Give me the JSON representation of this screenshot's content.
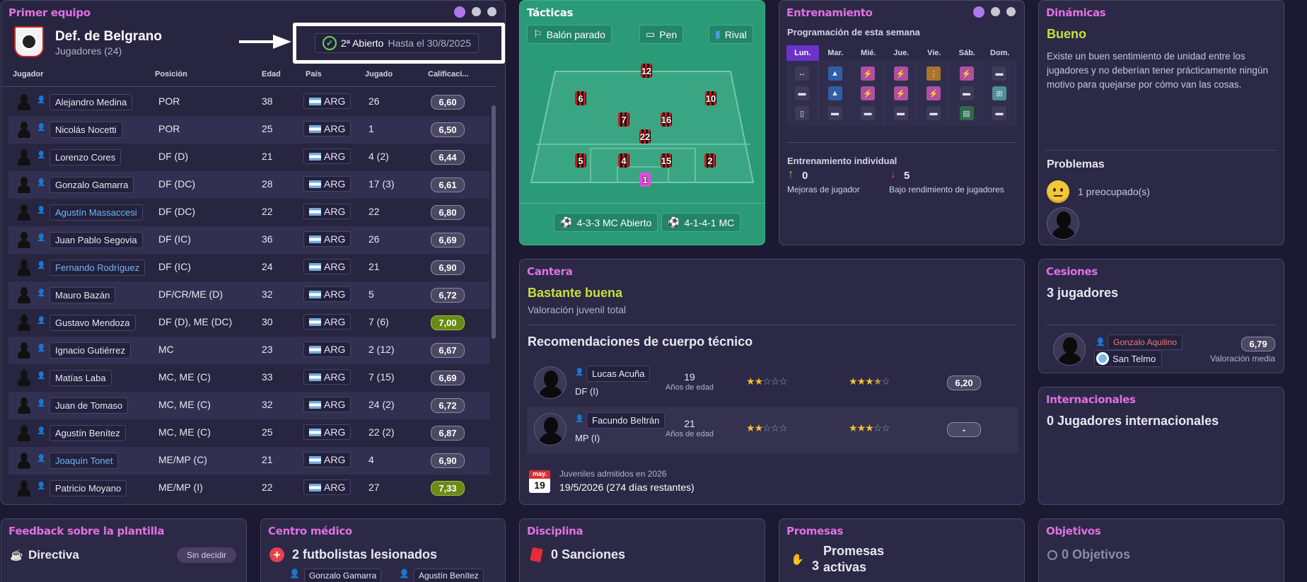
{
  "squad": {
    "title": "Primer equipo",
    "club": "Def. de Belgrano",
    "count": "Jugadores (24)",
    "status_label": "2ª Abierto",
    "status_until": "Hasta el 30/8/2025",
    "columns": [
      "Jugador",
      "Posición",
      "Edad",
      "País",
      "Jugado",
      "Calificaci..."
    ],
    "players": [
      {
        "name": "Alejandro Medina",
        "pos": "POR",
        "age": "38",
        "country": "ARG",
        "played": "26",
        "rating": "6,60",
        "link": false,
        "green": false
      },
      {
        "name": "Nicolás Nocetti",
        "pos": "POR",
        "age": "25",
        "country": "ARG",
        "played": "1",
        "rating": "6,50",
        "link": false,
        "green": false
      },
      {
        "name": "Lorenzo Cores",
        "pos": "DF (D)",
        "age": "21",
        "country": "ARG",
        "played": "4 (2)",
        "rating": "6,44",
        "link": false,
        "green": false
      },
      {
        "name": "Gonzalo Gamarra",
        "pos": "DF (DC)",
        "age": "28",
        "country": "ARG",
        "played": "17 (3)",
        "rating": "6,61",
        "link": false,
        "green": false
      },
      {
        "name": "Agustín Massaccesi",
        "pos": "DF (DC)",
        "age": "22",
        "country": "ARG",
        "played": "22",
        "rating": "6,80",
        "link": true,
        "green": false
      },
      {
        "name": "Juan Pablo Segovia",
        "pos": "DF (IC)",
        "age": "36",
        "country": "ARG",
        "played": "26",
        "rating": "6,69",
        "link": false,
        "green": false
      },
      {
        "name": "Fernando Rodríguez",
        "pos": "DF (IC)",
        "age": "24",
        "country": "ARG",
        "played": "21",
        "rating": "6,90",
        "link": true,
        "green": false
      },
      {
        "name": "Mauro Bazán",
        "pos": "DF/CR/ME (D)",
        "age": "32",
        "country": "ARG",
        "played": "5",
        "rating": "6,72",
        "link": false,
        "green": false
      },
      {
        "name": "Gustavo Mendoza",
        "pos": "DF (D), ME (DC)",
        "age": "30",
        "country": "ARG",
        "played": "7 (6)",
        "rating": "7,00",
        "link": false,
        "green": true
      },
      {
        "name": "Ignacio Gutiérrez",
        "pos": "MC",
        "age": "23",
        "country": "ARG",
        "played": "2 (12)",
        "rating": "6,67",
        "link": false,
        "green": false
      },
      {
        "name": "Matías Laba",
        "pos": "MC, ME (C)",
        "age": "33",
        "country": "ARG",
        "played": "7 (15)",
        "rating": "6,69",
        "link": false,
        "green": false
      },
      {
        "name": "Juan de Tomaso",
        "pos": "MC, ME (C)",
        "age": "32",
        "country": "ARG",
        "played": "24 (2)",
        "rating": "6,72",
        "link": false,
        "green": false
      },
      {
        "name": "Agustín Benítez",
        "pos": "MC, ME (C)",
        "age": "25",
        "country": "ARG",
        "played": "22 (2)",
        "rating": "6,87",
        "link": false,
        "green": false
      },
      {
        "name": "Joaquín Tonet",
        "pos": "ME/MP (C)",
        "age": "21",
        "country": "ARG",
        "played": "4",
        "rating": "6,90",
        "link": true,
        "green": false
      },
      {
        "name": "Patricio Moyano",
        "pos": "ME/MP (I)",
        "age": "22",
        "country": "ARG",
        "played": "27",
        "rating": "7,33",
        "link": false,
        "green": true
      }
    ]
  },
  "tactics": {
    "title": "Tácticas",
    "tabs": [
      "Balón parado",
      "Pen",
      "Rival"
    ],
    "players": [
      "12",
      "6",
      "10",
      "7",
      "16",
      "22",
      "5",
      "4",
      "15",
      "2",
      "1"
    ],
    "formations": [
      "4-3-3 MC Abierto",
      "4-1-4-1 MC"
    ]
  },
  "training": {
    "title": "Entrenamiento",
    "schedule_label": "Programación de esta semana",
    "days": [
      "Lun.",
      "Mar.",
      "Mié.",
      "Jue.",
      "Vie.",
      "Sáb.",
      "Dom."
    ],
    "individual_label": "Entrenamiento individual",
    "improving_count": "0",
    "improving_label": "Mejoras de jugador",
    "under_count": "5",
    "under_label": "Bajo rendimiento de jugadores"
  },
  "dynamics": {
    "title": "Dinámicas",
    "status": "Bueno",
    "desc": "Existe un buen sentimiento de unidad entre los jugadores y no deberían tener prácticamente ningún motivo para quejarse por cómo van las cosas.",
    "problems_label": "Problemas",
    "worried": "1 preocupado(s)"
  },
  "youth": {
    "title": "Cantera",
    "status": "Bastante buena",
    "sub": "Valoración juvenil total",
    "recs_title": "Recomendaciones de cuerpo técnico",
    "players": [
      {
        "name": "Lucas Acuña",
        "pos": "DF (I)",
        "age": "19",
        "age_label": "Años de edad",
        "ability_stars": 2,
        "potential_stars": 3.5,
        "rating": "6,20"
      },
      {
        "name": "Facundo Beltrán",
        "pos": "MP (I)",
        "age": "21",
        "age_label": "Años de edad",
        "ability_stars": 2,
        "potential_stars": 3,
        "rating": "-"
      }
    ],
    "cal_month": "may.",
    "cal_day": "19",
    "intake_label": "Juveniles admitidos en 2026",
    "intake_date": "19/5/2026 (274 días restantes)"
  },
  "loans": {
    "title": "Cesiones",
    "count": "3 jugadores",
    "player": "Gonzalo Aquilino",
    "club": "San Telmo",
    "rating": "6,79",
    "rating_label": "Valoración media"
  },
  "internationals": {
    "title": "Internacionales",
    "count": "0 Jugadores internacionales"
  },
  "feedback": {
    "title": "Feedback sobre la plantilla",
    "board": "Directiva",
    "undecided": "Sin decidir"
  },
  "medical": {
    "title": "Centro médico",
    "injured": "2 futbolistas lesionados",
    "players": [
      "Gonzalo Gamarra",
      "Agustín Benítez"
    ]
  },
  "discipline": {
    "title": "Disciplina",
    "count": "0 Sanciones"
  },
  "promises": {
    "title": "Promesas",
    "count": "3",
    "label": "Promesas activas"
  },
  "objectives": {
    "title": "Objetivos",
    "count": "0 Objetivos"
  }
}
